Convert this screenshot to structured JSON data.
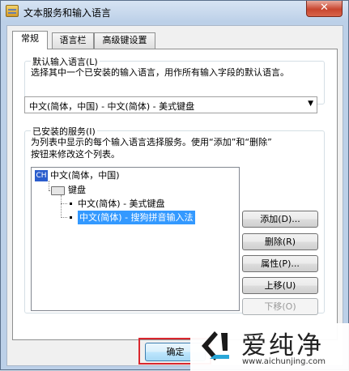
{
  "window": {
    "title": "文本服务和输入语言",
    "close_glyph": "✕"
  },
  "tabs": [
    {
      "label": "常规",
      "active": true
    },
    {
      "label": "语言栏",
      "active": false
    },
    {
      "label": "高级键设置",
      "active": false
    }
  ],
  "default_lang": {
    "group_title": "默认输入语言(L)",
    "description": "选择其中一个已安装的输入语言，用作所有输入字段的默认语言。",
    "selected": "中文(简体，中国) - 中文(简体) - 美式键盘",
    "arrow": "▼"
  },
  "installed": {
    "group_title": "已安装的服务(I)",
    "description_line1": "为列表中显示的每个输入语言选择服务。使用“添加”和“删除”",
    "description_line2": "按钮来修改这个列表。",
    "tree": {
      "lang_badge": "CH",
      "lang_label": "中文(简体，中国)",
      "keyboard_label": "键盘",
      "items": [
        {
          "label": "中文(简体) - 美式键盘",
          "selected": false
        },
        {
          "label": "中文(简体) - 搜狗拼音输入法",
          "selected": true
        }
      ]
    },
    "buttons": {
      "add": "添加(D)...",
      "remove": "删除(R)",
      "properties": "属性(P)...",
      "move_up": "上移(U)",
      "move_down": "下移(O)"
    }
  },
  "footer": {
    "ok": "确定"
  },
  "watermark": {
    "brand": "爱纯净",
    "url": "www.aichunjing.com"
  },
  "colors": {
    "selection": "#3399ff",
    "highlight_box": "#d9272e",
    "badge": "#2b5dcd"
  }
}
